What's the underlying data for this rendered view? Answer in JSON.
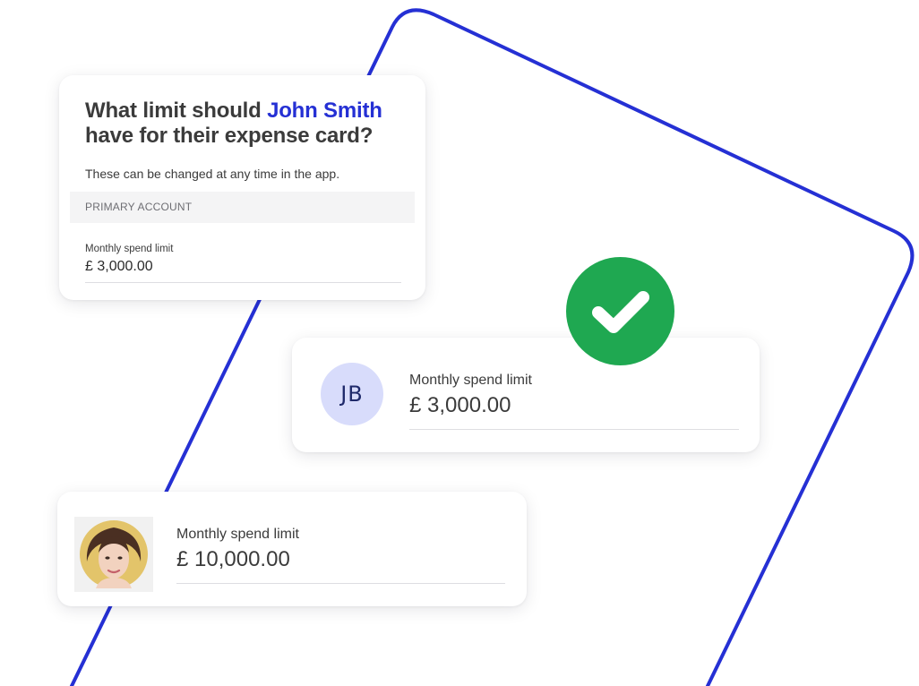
{
  "colors": {
    "accent_blue": "#2530d4",
    "success_green": "#1fa851",
    "avatar_bg": "#d8dcfb",
    "text_dark": "#3b3b3b"
  },
  "question_card": {
    "title_prefix": "What limit should ",
    "person_name": "John Smith",
    "title_suffix": "have for their expense card?",
    "subtitle": "These can be changed at any time in the app.",
    "section_label": "PRIMARY ACCOUNT",
    "field_label": "Monthly spend limit",
    "field_value": "£ 3,000.00"
  },
  "status_badge": {
    "icon": "checkmark-icon"
  },
  "jb_card": {
    "avatar_initials": "JB",
    "label": "Monthly spend limit",
    "value": "£ 3,000.00"
  },
  "photo_card": {
    "avatar_icon": "user-photo-avatar",
    "label": "Monthly spend limit",
    "value": "£ 10,000.00"
  }
}
